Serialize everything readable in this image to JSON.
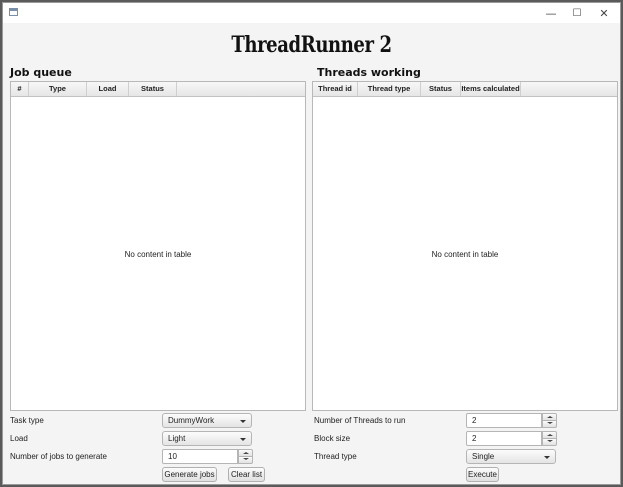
{
  "app": {
    "title": "ThreadRunner 2"
  },
  "window_controls": {
    "minimize": "—",
    "maximize": "☐",
    "close": "✕"
  },
  "job_queue": {
    "title": "Job queue",
    "columns": [
      "#",
      "Type",
      "Load",
      "Status"
    ],
    "empty_message": "No content in table"
  },
  "threads_working": {
    "title": "Threads working",
    "columns": [
      "Thread id",
      "Thread type",
      "Status",
      "Items calculated"
    ],
    "empty_message": "No content in table"
  },
  "left_form": {
    "task_type_label": "Task type",
    "task_type_value": "DummyWork",
    "load_label": "Load",
    "load_value": "Light",
    "jobs_label": "Number of jobs to generate",
    "jobs_value": "10",
    "generate_button": "Generate jobs",
    "clear_button": "Clear list"
  },
  "right_form": {
    "threads_label": "Number of Threads to run",
    "threads_value": "2",
    "block_size_label": "Block size",
    "block_size_value": "2",
    "thread_type_label": "Thread type",
    "thread_type_value": "Single",
    "execute_button": "Execute"
  }
}
